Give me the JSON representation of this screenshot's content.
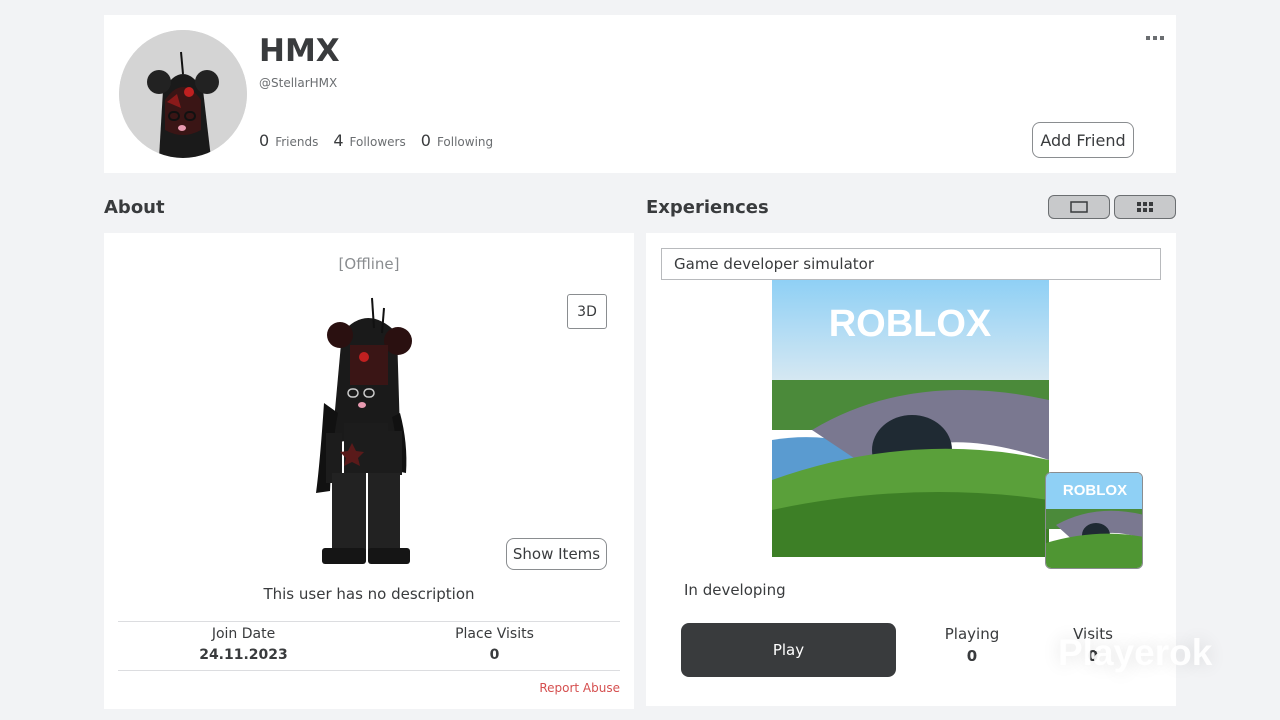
{
  "profile": {
    "display_name": "HMX",
    "username": "@StellarHMX",
    "stats": [
      {
        "count": "0",
        "label": "Friends"
      },
      {
        "count": "4",
        "label": "Followers"
      },
      {
        "count": "0",
        "label": "Following"
      }
    ],
    "add_friend_label": "Add Friend",
    "more_icon": "ellipsis-icon"
  },
  "about": {
    "title": "About",
    "status": "[Offline]",
    "btn_3d_label": "3D",
    "show_items_label": "Show Items",
    "description": "This user has no description",
    "join_date_label": "Join Date",
    "join_date_value": "24.11.2023",
    "place_visits_label": "Place Visits",
    "place_visits_value": "0",
    "report_label": "Report Abuse"
  },
  "experiences": {
    "title": "Experiences",
    "game_title": "Game developer simulator",
    "thumbnail_logo": "ROBLOX",
    "game_description": "In developing",
    "play_label": "Play",
    "playing_label": "Playing",
    "playing_value": "0",
    "visits_label": "Visits",
    "visits_value": "0"
  },
  "watermark": "Playerok",
  "colors": {
    "accent_dark": "#393b3d",
    "report": "#d54f4f",
    "background": "#f2f3f5"
  }
}
